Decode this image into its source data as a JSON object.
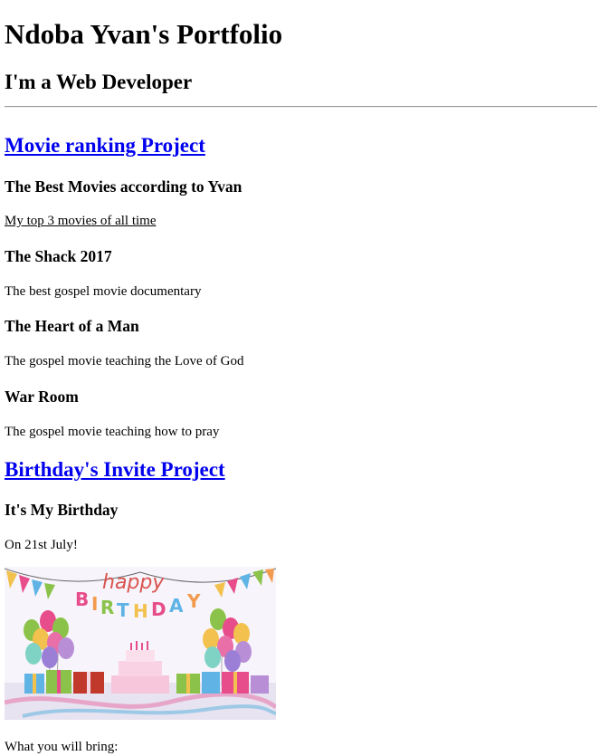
{
  "header": {
    "title": "Ndoba Yvan's Portfolio",
    "subtitle": "I'm a Web Developer"
  },
  "projects": {
    "movie": {
      "link": "Movie ranking Project",
      "heading": "The Best Movies according to Yvan",
      "intro": "My top 3 movies of all time",
      "movies": [
        {
          "title": "The Shack 2017",
          "desc": "The best gospel movie documentary"
        },
        {
          "title": "The Heart of a Man",
          "desc": "The gospel movie teaching the Love of God"
        },
        {
          "title": "War Room",
          "desc": "The gospel movie teaching how to pray"
        }
      ]
    },
    "birthday": {
      "link": "Birthday's Invite Project",
      "heading": "It's My Birthday",
      "date": "On 21st July!",
      "image_text": "happy BIRTHDAY",
      "bring_label": "What you will bring:"
    }
  },
  "colors": {
    "link": "#0000ee",
    "text": "#000000",
    "background": "#ffffff"
  }
}
